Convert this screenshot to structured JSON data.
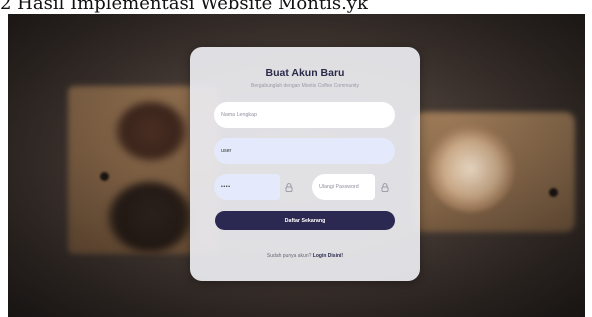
{
  "caption": "2 Hasil Implementasi Website Montis.yk",
  "form": {
    "title": "Buat Akun Baru",
    "subtitle": "Bergabunglah dengan Montis Coffee Community",
    "fields": {
      "full_name_placeholder": "Nama Lengkap",
      "username_value": "user",
      "password_value": "••••",
      "confirm_placeholder": "Ulangi Password"
    },
    "submit_label": "Daftar Sekarang",
    "login_prompt": "Sudah punya akun?",
    "login_link": "Login Disini!"
  },
  "icons": {
    "password_lock": "lock-icon",
    "confirm_lock": "lock-icon"
  },
  "colors": {
    "primary": "#2b2952",
    "input_active": "#e4e9fb",
    "card": "#ececf0"
  }
}
